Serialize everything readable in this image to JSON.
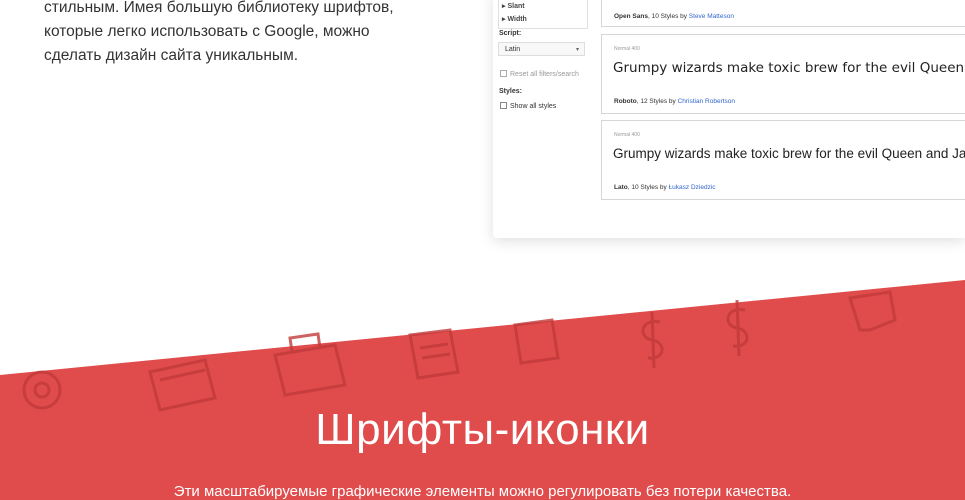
{
  "intro": {
    "lines": [
      "стильным. Имея большую библиотеку шрифтов,",
      "которые легко  использовать с Google, можно",
      "сделать дизайн сайта уникальным."
    ]
  },
  "screenshot": {
    "sidebar": {
      "filters": [
        "▸ Slant",
        "▸ Width"
      ],
      "script_label": "Script:",
      "script_value": "Latin",
      "reset_text": "Reset all filters/search",
      "styles_label": "Styles:",
      "show_all": "Show all styles"
    },
    "cards": [
      {
        "meta_font": "Open Sans",
        "meta_styles": ", 10 Styles by ",
        "meta_author": "Steve Matteson"
      },
      {
        "weight_label": "Normal 400",
        "sample": "Grumpy wizards make toxic brew for the evil Queen and Jack.",
        "meta_font": "Roboto",
        "meta_styles": ", 12 Styles by ",
        "meta_author": "Christian Robertson"
      },
      {
        "weight_label": "Normal 400",
        "sample": "Grumpy wizards make toxic brew for the evil Queen and Jack.",
        "meta_font": "Lato",
        "meta_styles": ", 10 Styles by ",
        "meta_author": "Łukasz Dziedzic"
      }
    ]
  },
  "banner": {
    "color": "#e04b4b",
    "title": "Шрифты-иконки",
    "subtitle": "Эти масштабируемые графические элементы можно регулировать без потери качества."
  }
}
